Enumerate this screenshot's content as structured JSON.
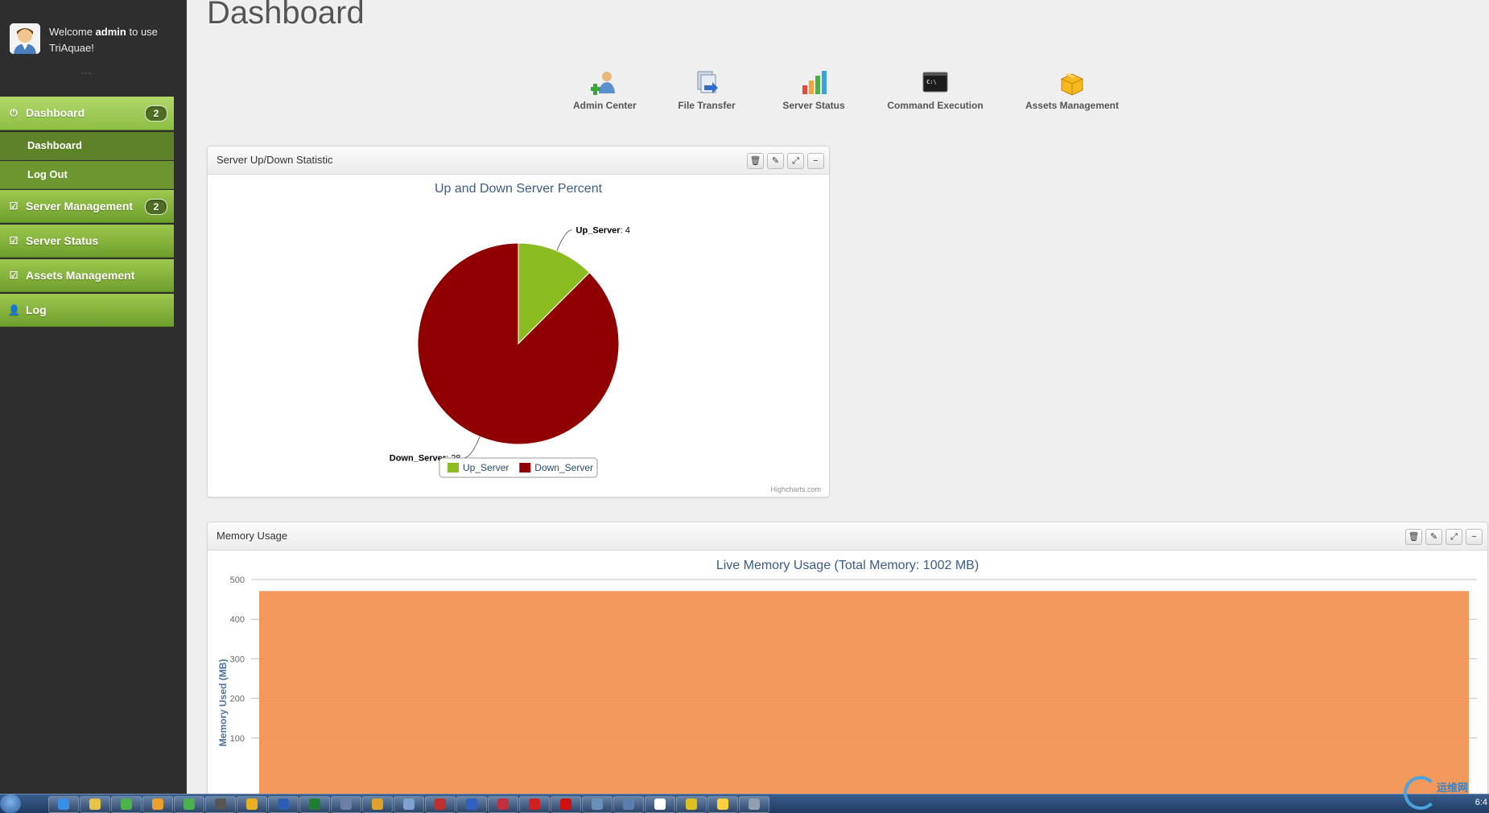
{
  "sidebar": {
    "welcome_prefix": "Welcome",
    "user": "admin",
    "welcome_suffix": "to use TriAquae!",
    "items": [
      {
        "label": "Dashboard",
        "badge": "2",
        "icon": "power-icon"
      },
      {
        "label": "Server Management",
        "badge": "2",
        "icon": "check-icon"
      },
      {
        "label": "Server Status",
        "icon": "check-icon"
      },
      {
        "label": "Assets Management",
        "icon": "check-icon"
      },
      {
        "label": "Log",
        "icon": "user-icon"
      }
    ],
    "subitems": [
      {
        "label": "Dashboard"
      },
      {
        "label": "Log Out"
      }
    ]
  },
  "main": {
    "title": "Dashboard",
    "shortcuts": [
      {
        "label": "Admin Center",
        "icon": "admin-user-icon"
      },
      {
        "label": "File Transfer",
        "icon": "file-transfer-icon"
      },
      {
        "label": "Server Status",
        "icon": "bar-chart-icon"
      },
      {
        "label": "Command Execution",
        "icon": "terminal-icon"
      },
      {
        "label": "Assets Management",
        "icon": "box-icon"
      }
    ]
  },
  "pie_box": {
    "header": "Server Up/Down Statistic",
    "credits": "Highcharts.com"
  },
  "memory_box": {
    "header": "Memory Usage"
  },
  "chart_data": [
    {
      "type": "pie",
      "title": "Up and Down Server Percent",
      "slices": [
        {
          "name": "Up_Server",
          "value": 4,
          "color": "#8bbc21"
        },
        {
          "name": "Down_Server",
          "value": 28,
          "color": "#910000"
        }
      ],
      "legend": "bottom-center"
    },
    {
      "type": "area",
      "title": "Live Memory Usage (Total Memory: 1002 MB)",
      "ylabel": "Memory Used (MB)",
      "ylim": [
        0,
        500
      ],
      "yticks": [
        100,
        200,
        300,
        400,
        500
      ],
      "values": [
        471,
        471
      ],
      "color": "#f19452",
      "grid": true
    }
  ],
  "taskbar": {
    "clock": "6:4",
    "watermark": "运维网"
  }
}
